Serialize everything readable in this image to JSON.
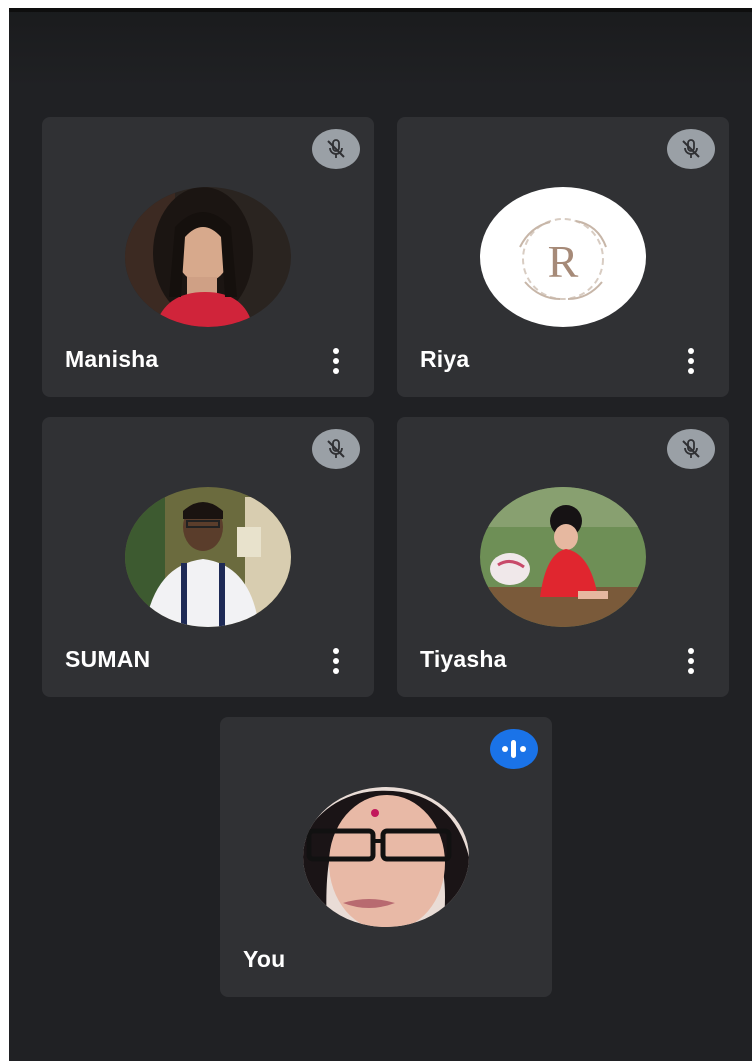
{
  "participants": [
    {
      "name": "Manisha",
      "mic": "muted"
    },
    {
      "name": "Riya",
      "mic": "muted",
      "avatar_letter": "R"
    },
    {
      "name": "SUMAN",
      "mic": "muted"
    },
    {
      "name": "Tiyasha",
      "mic": "muted"
    },
    {
      "name": "You",
      "mic": "speaking"
    }
  ],
  "icons": {
    "muted": "mic-off-icon",
    "speaking": "speaking-indicator-icon",
    "more": "more-vert-icon"
  },
  "colors": {
    "background": "#202124",
    "tile": "#303134",
    "muted_badge": "#9aa0a6",
    "speaking_badge": "#1a73e8",
    "text": "#ffffff"
  }
}
